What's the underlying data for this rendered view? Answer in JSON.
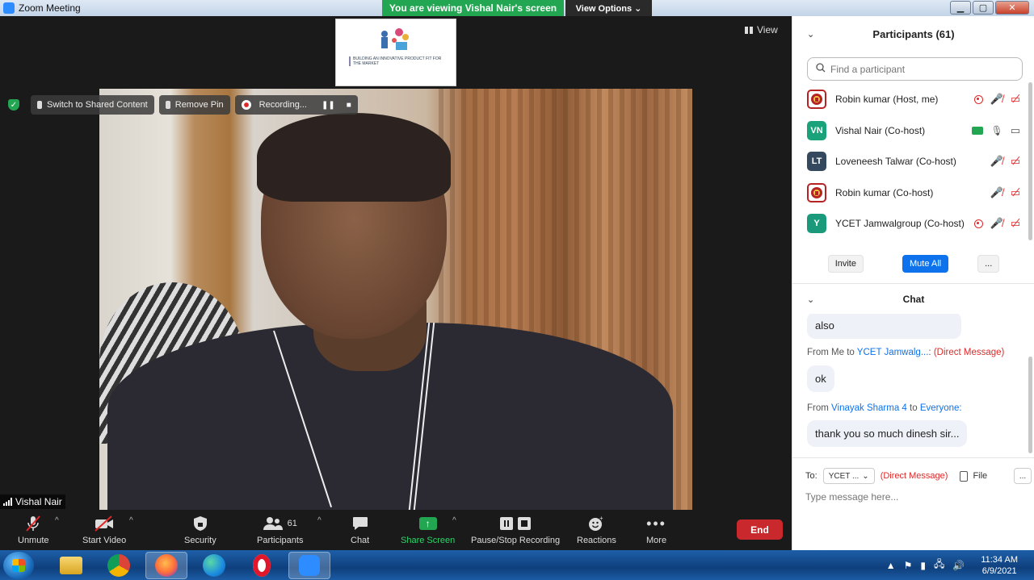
{
  "window": {
    "title": "Zoom Meeting"
  },
  "banner": {
    "viewing_text": "You are viewing Vishal Nair's screen",
    "view_options": "View Options ⌄"
  },
  "meeting": {
    "view_label": "View",
    "switch_shared": "Switch to Shared Content",
    "remove_pin": "Remove Pin",
    "recording": "Recording...",
    "speaker_name": "Vishal Nair",
    "thumbnail_caption": "BUILDING AN INNOVATIVE PRODUCT FIT FOR THE MARKET"
  },
  "toolbar": {
    "unmute": "Unmute",
    "start_video": "Start Video",
    "security": "Security",
    "participants": "Participants",
    "participants_count": "61",
    "chat": "Chat",
    "share_screen": "Share Screen",
    "pause_stop": "Pause/Stop Recording",
    "reactions": "Reactions",
    "more": "More",
    "end": "End"
  },
  "participants_panel": {
    "title": "Participants (61)",
    "search_placeholder": "Find a participant",
    "list": [
      {
        "initials": "",
        "name": "Robin kumar (Host, me)",
        "color": "#b52424"
      },
      {
        "initials": "VN",
        "name": "Vishal Nair (Co-host)",
        "color": "#1aa37a"
      },
      {
        "initials": "LT",
        "name": "Loveneesh Talwar (Co-host)",
        "color": "#34485e"
      },
      {
        "initials": "",
        "name": "Robin kumar (Co-host)",
        "color": "#b52424"
      },
      {
        "initials": "Y",
        "name": "YCET Jamwalgroup (Co-host)",
        "color": "#1a9a7a"
      }
    ],
    "invite": "Invite",
    "mute_all": "Mute All",
    "more": "..."
  },
  "chat_panel": {
    "title": "Chat",
    "messages": {
      "m1_text": "also",
      "m2_from": "From Me to",
      "m2_to": "YCET Jamwalg...",
      "m2_sep": ":",
      "m2_dm": "(Direct Message)",
      "m2_text": "ok",
      "m3_from": "From",
      "m3_sender": "Vinayak Sharma 4",
      "m3_to_word": "to",
      "m3_to": "Everyone:",
      "m3_text": "thank you so much dinesh sir..."
    },
    "to_label": "To:",
    "to_value": "YCET ...",
    "direct": "(Direct Message)",
    "file": "File",
    "more": "...",
    "input_placeholder": "Type message here..."
  },
  "taskbar": {
    "time": "11:34 AM",
    "date": "6/9/2021"
  },
  "colors": {
    "zoom_blue": "#0e72ed",
    "green": "#23a651",
    "end_red": "#c9282d"
  }
}
